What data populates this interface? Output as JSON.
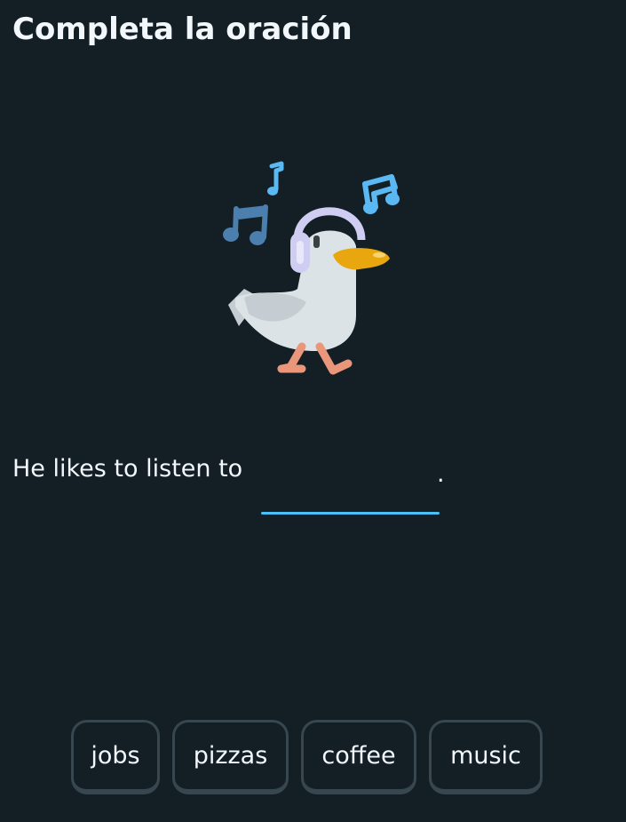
{
  "header": {
    "title": "Completa la oración"
  },
  "illustration": {
    "character": "seagull-with-headphones",
    "icons": [
      "music-note-icon",
      "music-note-icon",
      "double-music-note-icon",
      "double-music-note-icon"
    ],
    "colors": {
      "body": "#dce3e6",
      "beak": "#e8a60f",
      "headphones": "#cfcdf2",
      "legs": "#e9967a",
      "note_dark": "#4a7fae",
      "note_light": "#5ab8f2"
    }
  },
  "exercise": {
    "sentence_before": "He likes to listen to",
    "sentence_after": ".",
    "blank_color": "#49c0f8"
  },
  "word_bank": {
    "options": [
      {
        "label": "jobs"
      },
      {
        "label": "pizzas"
      },
      {
        "label": "coffee"
      },
      {
        "label": "music"
      }
    ]
  }
}
